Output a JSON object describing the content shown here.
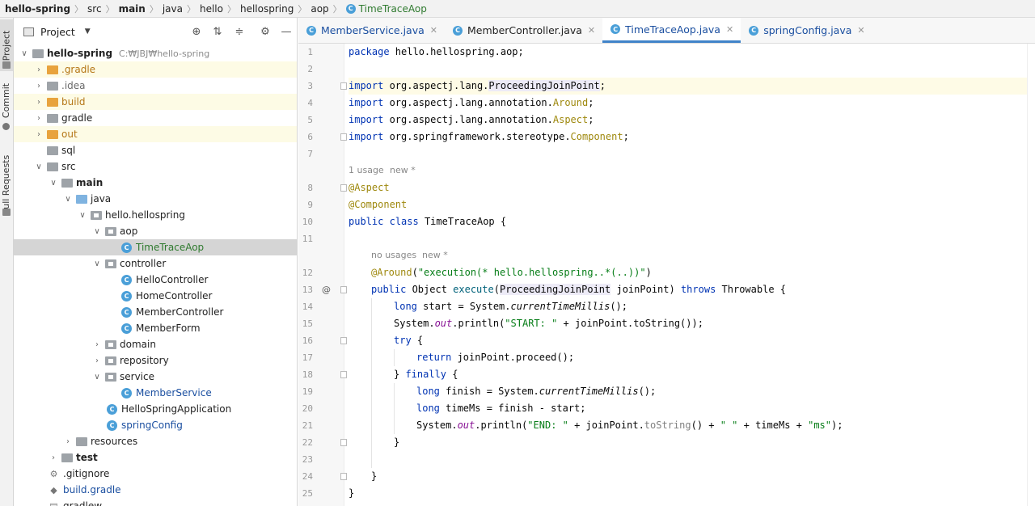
{
  "breadcrumb": {
    "segments": [
      "hello-spring",
      "src",
      "main",
      "java",
      "hello",
      "hellospring",
      "aop"
    ],
    "file": "TimeTraceAop"
  },
  "side_tabs": {
    "project": "Project",
    "commit": "Commit",
    "pull_requests": "Pull Requests"
  },
  "project_panel": {
    "title": "Project",
    "root": {
      "name": "hello-spring",
      "path": "C:₩JBJ₩hello-spring"
    },
    "items": [
      {
        "label": ".gradle"
      },
      {
        "label": ".idea"
      },
      {
        "label": "build"
      },
      {
        "label": "gradle"
      },
      {
        "label": "out"
      },
      {
        "label": "sql"
      },
      {
        "label": "src"
      },
      {
        "label": "main"
      },
      {
        "label": "java"
      },
      {
        "label": "hello.hellospring"
      },
      {
        "label": "aop"
      },
      {
        "label": "TimeTraceAop"
      },
      {
        "label": "controller"
      },
      {
        "label": "HelloController"
      },
      {
        "label": "HomeController"
      },
      {
        "label": "MemberController"
      },
      {
        "label": "MemberForm"
      },
      {
        "label": "domain"
      },
      {
        "label": "repository"
      },
      {
        "label": "service"
      },
      {
        "label": "MemberService"
      },
      {
        "label": "HelloSpringApplication"
      },
      {
        "label": "springConfig"
      },
      {
        "label": "resources"
      },
      {
        "label": "test"
      },
      {
        "label": ".gitignore"
      },
      {
        "label": "build.gradle"
      },
      {
        "label": "gradlew"
      }
    ]
  },
  "tabs": [
    {
      "label": "MemberService.java"
    },
    {
      "label": "MemberController.java"
    },
    {
      "label": "TimeTraceAop.java"
    },
    {
      "label": "springConfig.java"
    }
  ],
  "hints": {
    "class_usage": "1 usage",
    "class_new": "new *",
    "method_usage": "no usages",
    "method_new": "new *"
  },
  "code": {
    "line_numbers": [
      "1",
      "2",
      "3",
      "4",
      "5",
      "6",
      "7",
      "8",
      "9",
      "10",
      "11",
      "12",
      "13",
      "14",
      "15",
      "16",
      "17",
      "18",
      "19",
      "20",
      "21",
      "22",
      "23",
      "24",
      "25"
    ],
    "l1": {
      "a": "package",
      "b": " hello.hellospring.aop;"
    },
    "l3": {
      "a": "import",
      "b": " org.aspectj.lang.",
      "c": "ProceedingJoinPoint",
      "d": ";"
    },
    "l4": {
      "a": "import",
      "b": " org.aspectj.lang.annotation.",
      "c": "Around",
      "d": ";"
    },
    "l5": {
      "a": "import",
      "b": " org.aspectj.lang.annotation.",
      "c": "Aspect",
      "d": ";"
    },
    "l6": {
      "a": "import",
      "b": " org.springframework.stereotype.",
      "c": "Component",
      "d": ";"
    },
    "l8": {
      "a": "@Aspect"
    },
    "l9": {
      "a": "@Component"
    },
    "l10": {
      "a": "public",
      "b": " ",
      "c": "class",
      "d": " TimeTraceAop {"
    },
    "l12": {
      "a": "@Around",
      "b": "(",
      "c": "\"execution(* hello.hellospring..*(..))\"",
      "d": ")"
    },
    "l13": {
      "a": "public",
      "b": " Object ",
      "c": "execute",
      "d": "(",
      "e": "ProceedingJoinPoint",
      "f": " joinPoint) ",
      "g": "throws",
      "h": " Throwable {"
    },
    "l14": {
      "a": "long",
      "b": " start = System.",
      "c": "currentTimeMillis",
      "d": "();"
    },
    "l15": {
      "a": "System.",
      "b": "out",
      "c": ".println(",
      "d": "\"START: \"",
      "e": " + joinPoint.toString());"
    },
    "l16": {
      "a": "try",
      "b": " {"
    },
    "l17": {
      "a": "return",
      "b": " joinPoint.proceed();"
    },
    "l18": {
      "a": "} ",
      "b": "finally",
      "c": " {"
    },
    "l19": {
      "a": "long",
      "b": " finish = System.",
      "c": "currentTimeMillis",
      "d": "();"
    },
    "l20": {
      "a": "long",
      "b": " timeMs = finish - start;"
    },
    "l21": {
      "a": "System.",
      "b": "out",
      "c": ".println(",
      "d": "\"END: \"",
      "e": " + joinPoint.",
      "f": "toString",
      "g": "() + ",
      "h": "\" \"",
      "i": " + timeMs + ",
      "j": "\"ms\"",
      "k": ");"
    },
    "l22": {
      "a": "}"
    },
    "l24": {
      "a": "}"
    },
    "l25": {
      "a": "}"
    },
    "gutter_mark": "@"
  }
}
